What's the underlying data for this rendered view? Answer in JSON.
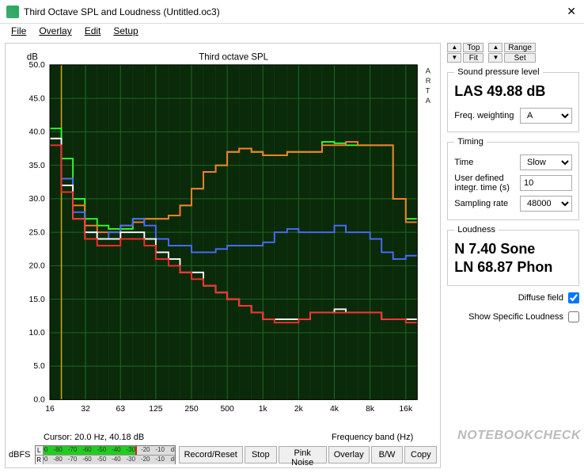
{
  "window": {
    "title": "Third Octave SPL and Loudness (Untitled.oc3)"
  },
  "menu": {
    "file": "File",
    "overlay": "Overlay",
    "edit": "Edit",
    "setup": "Setup"
  },
  "chart_title": "Third octave SPL",
  "y_unit": "dB",
  "cursor_label": "Cursor:",
  "cursor_value": "20.0 Hz, 40.18 dB",
  "freq_band_label": "Frequency band (Hz)",
  "arta_label": "A R T A",
  "dbfs_label": "dBFS",
  "meter": {
    "l": "L",
    "r": "R",
    "ticks": [
      "-90",
      "-80",
      "-70",
      "-60",
      "-50",
      "-40",
      "-30",
      "-20",
      "-10",
      "dB"
    ],
    "l_val": -30,
    "r_val": -100
  },
  "btns": {
    "record": "Record/Reset",
    "stop": "Stop",
    "pink": "Pink Noise",
    "overlay": "Overlay",
    "bw": "B/W",
    "copy": "Copy"
  },
  "topfit": {
    "top": "Top",
    "fit": "Fit",
    "range": "Range",
    "set": "Set"
  },
  "spl": {
    "legend": "Sound pressure level",
    "value": "LAS 49.88 dB",
    "freq_weight_label": "Freq. weighting",
    "freq_weight_value": "A"
  },
  "timing": {
    "legend": "Timing",
    "time_label": "Time",
    "time_value": "Slow",
    "integ_label": "User defined integr. time (s)",
    "integ_value": "10",
    "rate_label": "Sampling rate",
    "rate_value": "48000"
  },
  "loudness": {
    "legend": "Loudness",
    "sone": "N 7.40 Sone",
    "phon": "LN 68.87 Phon"
  },
  "diffuse": {
    "label": "Diffuse field",
    "checked": true
  },
  "show_specific": {
    "label": "Show Specific Loudness",
    "checked": false
  },
  "watermark": "NOTEBOOKCHECK",
  "chart_data": {
    "type": "line",
    "xlabel": "Frequency band (Hz)",
    "ylabel": "dB",
    "title": "Third octave SPL",
    "xscale": "log",
    "ylim": [
      0,
      50
    ],
    "xlim": [
      16,
      20000
    ],
    "xticks": [
      16,
      32,
      63,
      125,
      250,
      500,
      1000,
      2000,
      4000,
      8000,
      16000
    ],
    "yticks": [
      0,
      5,
      10,
      15,
      20,
      25,
      30,
      35,
      40,
      45,
      50
    ],
    "bands": [
      16,
      20,
      25,
      31.5,
      40,
      50,
      63,
      80,
      100,
      125,
      160,
      200,
      250,
      315,
      400,
      500,
      630,
      800,
      1000,
      1250,
      1600,
      2000,
      2500,
      3150,
      4000,
      5000,
      6300,
      8000,
      10000,
      12500,
      16000,
      20000
    ],
    "series": [
      {
        "name": "green",
        "color": "#2cff2c",
        "values": [
          40.5,
          36,
          30,
          27,
          26,
          25.5,
          25.5,
          27,
          27,
          27,
          27.5,
          29,
          31.5,
          34,
          35,
          37,
          37.5,
          37,
          36.5,
          36.5,
          37,
          37,
          37,
          38.5,
          38.3,
          38,
          38,
          38,
          38,
          30,
          27,
          27
        ]
      },
      {
        "name": "orange",
        "color": "#ff7a2c",
        "values": [
          39,
          33,
          29,
          26,
          25,
          25,
          26,
          26.5,
          27,
          27,
          27.5,
          29,
          31.5,
          34,
          35,
          37,
          37.5,
          37,
          36.5,
          36.5,
          37,
          37,
          37,
          38,
          38,
          38.5,
          38,
          38,
          38,
          30,
          26.5,
          26.5
        ]
      },
      {
        "name": "blue",
        "color": "#4c6cff",
        "values": [
          39,
          33,
          28,
          25,
          24,
          25,
          26,
          27,
          26,
          24,
          23,
          23,
          22,
          22,
          22.5,
          23,
          23,
          23,
          23.5,
          25,
          25.5,
          25,
          25,
          25,
          26,
          25,
          25,
          24,
          22,
          21,
          21.5,
          21.5
        ]
      },
      {
        "name": "white",
        "color": "#ffffff",
        "values": [
          39,
          32,
          27,
          25,
          24,
          24,
          25,
          25,
          24,
          22,
          21,
          19,
          19,
          17,
          16,
          15,
          14,
          13,
          12,
          12,
          12,
          12,
          13,
          13,
          13.5,
          13,
          13,
          13,
          12,
          12,
          12,
          12
        ]
      },
      {
        "name": "red",
        "color": "#ff2c2c",
        "values": [
          38,
          31,
          27,
          24,
          23,
          23,
          24,
          24,
          23,
          21,
          20,
          19,
          18,
          17,
          16,
          15,
          14,
          13,
          12,
          11.5,
          11.5,
          12,
          13,
          13,
          13,
          13,
          13,
          13,
          12,
          12,
          11.5,
          11.5
        ]
      }
    ]
  }
}
